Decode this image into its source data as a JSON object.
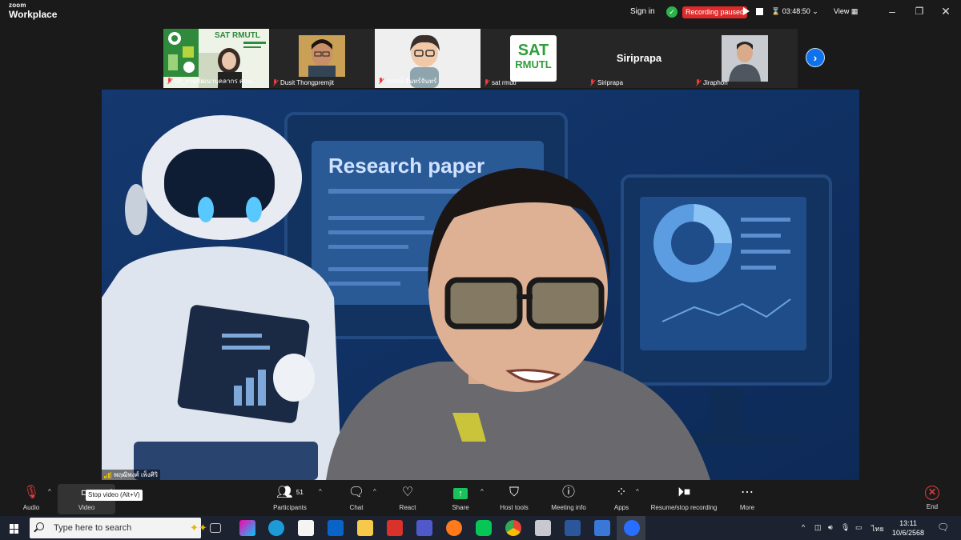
{
  "app": {
    "brand_top": "zoom",
    "brand_bottom": "Workplace"
  },
  "titlebar": {
    "sign_in": "Sign in",
    "recording_status": "Recording paused",
    "timer": "03:48:50",
    "view_label": "View"
  },
  "thumbnails": [
    {
      "name": "00_งานพัฒนาบุคลากร คณะ..."
    },
    {
      "name": "Dusit Thongpremjit"
    },
    {
      "name": "ปกรณ์ จันทร์จันทร์"
    },
    {
      "name": "sat rmutl",
      "logo_top": "SAT",
      "logo_bottom": "RMUTL"
    },
    {
      "name": "Siriprapa",
      "display_name": "Siriprapa"
    },
    {
      "name": "Jiraphon"
    }
  ],
  "main_video": {
    "speaker_name": "พฤฒิพงศ์ เพ็งศิริ",
    "slide_heading": "Research paper"
  },
  "toolbar": {
    "audio": "Audio",
    "video": "Video",
    "video_tooltip": "Stop video (Alt+V)",
    "participants": "Participants",
    "participants_count": "51",
    "chat": "Chat",
    "react": "React",
    "share": "Share",
    "host_tools": "Host tools",
    "meeting_info": "Meeting info",
    "apps": "Apps",
    "record": "Resume/stop recording",
    "more": "More",
    "end": "End"
  },
  "taskbar": {
    "search_placeholder": "Type here to search",
    "lang": "ไทย",
    "time": "13:11",
    "date": "10/6/2568"
  },
  "colors": {
    "accent": "#0e72ed",
    "recording": "#e02a2a",
    "share": "#19c25a",
    "end": "#e03c3c"
  }
}
